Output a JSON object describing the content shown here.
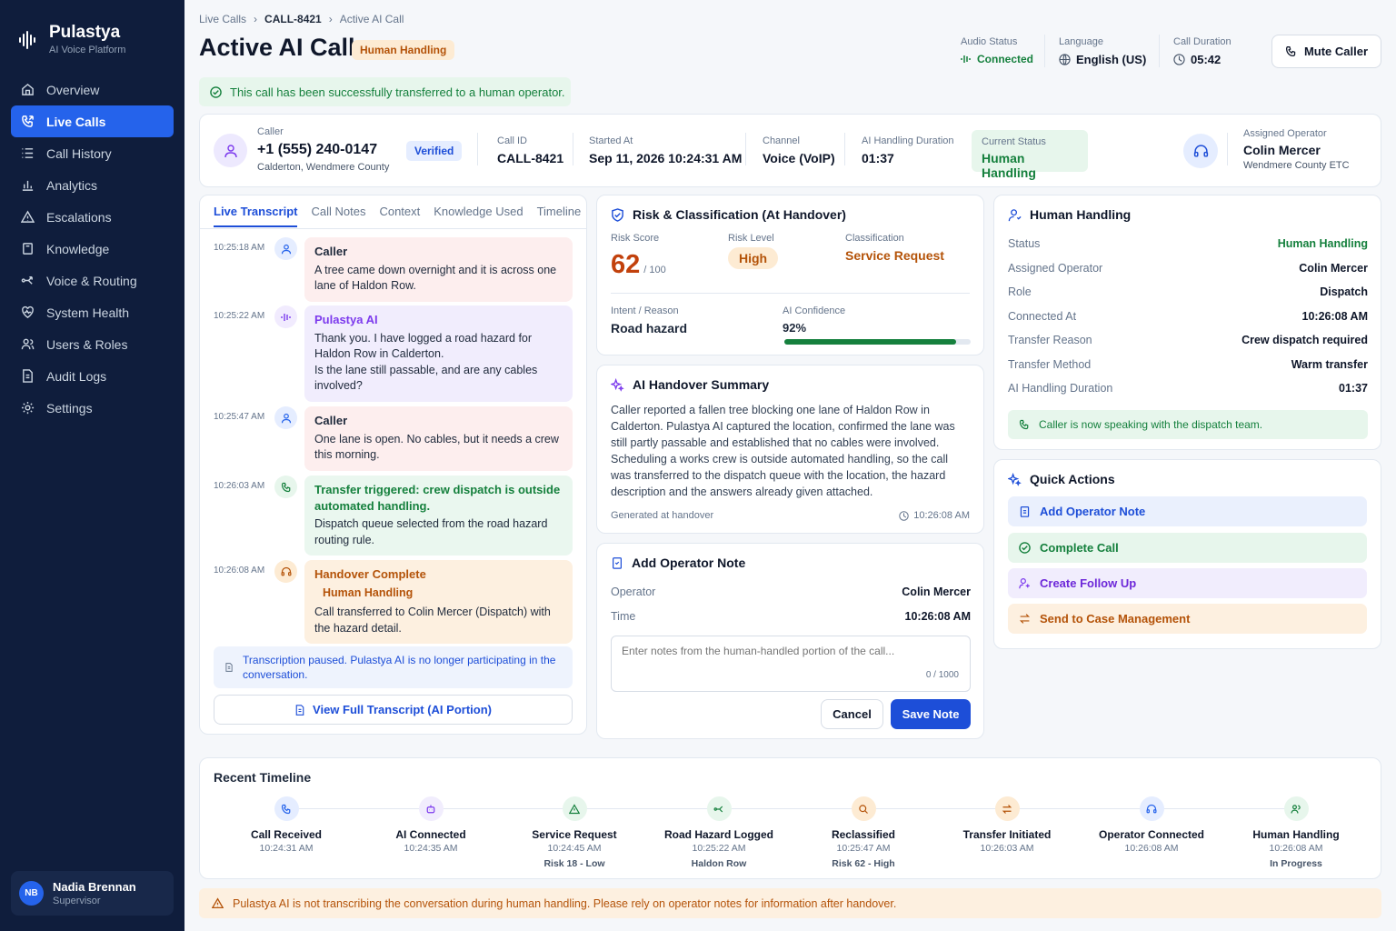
{
  "brand": {
    "name": "Pulastya",
    "subtitle": "AI Voice Platform"
  },
  "nav": [
    {
      "label": "Overview",
      "icon": "home-icon"
    },
    {
      "label": "Live Calls",
      "icon": "phone-call-icon",
      "active": true
    },
    {
      "label": "Call History",
      "icon": "list-icon"
    },
    {
      "label": "Analytics",
      "icon": "bar-chart-icon"
    },
    {
      "label": "Escalations",
      "icon": "warning-icon"
    },
    {
      "label": "Knowledge",
      "icon": "book-icon"
    },
    {
      "label": "Voice & Routing",
      "icon": "routing-icon"
    },
    {
      "label": "System Health",
      "icon": "heart-pulse-icon"
    },
    {
      "label": "Users & Roles",
      "icon": "users-icon"
    },
    {
      "label": "Audit Logs",
      "icon": "file-icon"
    },
    {
      "label": "Settings",
      "icon": "gear-icon"
    }
  ],
  "user": {
    "initials": "NB",
    "name": "Nadia Brennan",
    "role": "Supervisor"
  },
  "breadcrumb": {
    "a": "Live Calls",
    "b": "CALL-8421",
    "c": "Active AI Call"
  },
  "header": {
    "title": "Active AI Call",
    "badge": "Human Handling",
    "audio_label": "Audio Status",
    "audio_value": "Connected",
    "language_label": "Language",
    "language_value": "English (US)",
    "duration_label": "Call Duration",
    "duration_value": "05:42",
    "mute_button": "Mute Caller"
  },
  "transfer_banner": "This call has been successfully transferred to a human operator.",
  "caller_bar": {
    "caller_label": "Caller",
    "phone": "+1 (555) 240-0147",
    "location": "Calderton, Wendmere County",
    "verified": "Verified",
    "call_id_label": "Call ID",
    "call_id": "CALL-8421",
    "started_label": "Started At",
    "started": "Sep 11, 2026 10:24:31 AM",
    "channel_label": "Channel",
    "channel": "Voice (VoIP)",
    "ai_dur_label": "AI Handling Duration",
    "ai_dur": "01:37",
    "status_label": "Current Status",
    "status": "Human Handling",
    "operator_label": "Assigned Operator",
    "operator": "Colin Mercer",
    "operator_org": "Wendmere County ETC"
  },
  "transcript": {
    "tabs": [
      "Live Transcript",
      "Call Notes",
      "Context",
      "Knowledge Used",
      "Timeline"
    ],
    "messages": [
      {
        "time": "10:25:18 AM",
        "who": "Caller",
        "text": "A tree came down overnight and it is across one lane of Haldon Row."
      },
      {
        "time": "10:25:22 AM",
        "who": "Pulastya AI",
        "text": "Thank you. I have logged a road hazard for Haldon Row in Calderton.",
        "text2": "Is the lane still passable, and are any cables involved?"
      },
      {
        "time": "10:25:47 AM",
        "who": "Caller",
        "text": "One lane is open. No cables, but it needs a crew this morning."
      },
      {
        "time": "10:26:03 AM",
        "who": "Transfer triggered: crew dispatch is outside automated handling.",
        "text": "Dispatch queue selected from the road hazard routing rule."
      },
      {
        "time": "10:26:08 AM",
        "who": "Handover Complete",
        "tag": "Human Handling",
        "text": "Call transferred to Colin Mercer (Dispatch) with the hazard detail."
      }
    ],
    "paused": "Transcription paused. Pulastya AI is no longer participating in the conversation.",
    "view_full": "View Full Transcript (AI Portion)"
  },
  "risk": {
    "title": "Risk & Classification (At Handover)",
    "score_label": "Risk Score",
    "score": "62",
    "score_max": "/ 100",
    "level_label": "Risk Level",
    "level": "High",
    "class_label": "Classification",
    "class": "Service Request",
    "intent_label": "Intent / Reason",
    "intent": "Road hazard",
    "conf_label": "AI Confidence",
    "conf": "92%",
    "conf_value": 0.92
  },
  "summary": {
    "title": "AI Handover Summary",
    "text": "Caller reported a fallen tree blocking one lane of Haldon Row in Calderton. Pulastya AI captured the location, confirmed the lane was still partly passable and established that no cables were involved. Scheduling a works crew is outside automated handling, so the call was transferred to the dispatch queue with the location, the hazard description and the answers already given attached.",
    "generated": "Generated at handover",
    "generated_time": "10:26:08 AM"
  },
  "note": {
    "title": "Add Operator Note",
    "operator_label": "Operator",
    "operator": "Colin Mercer",
    "time_label": "Time",
    "time": "10:26:08 AM",
    "placeholder": "Enter notes from the human-handled portion of the call...",
    "counter": "0 / 1000",
    "cancel": "Cancel",
    "save": "Save Note"
  },
  "handling": {
    "title": "Human Handling",
    "rows": [
      {
        "k": "Status",
        "v": "Human Handling"
      },
      {
        "k": "Assigned Operator",
        "v": "Colin Mercer"
      },
      {
        "k": "Role",
        "v": "Dispatch"
      },
      {
        "k": "Connected At",
        "v": "10:26:08 AM"
      },
      {
        "k": "Transfer Reason",
        "v": "Crew dispatch required"
      },
      {
        "k": "Transfer Method",
        "v": "Warm transfer"
      },
      {
        "k": "AI Handling Duration",
        "v": "01:37"
      }
    ],
    "banner": "Caller is now speaking with the dispatch team."
  },
  "quick": {
    "title": "Quick Actions",
    "items": [
      "Add Operator Note",
      "Complete Call",
      "Create Follow Up",
      "Send to Case Management"
    ]
  },
  "timeline": {
    "title": "Recent Timeline",
    "items": [
      {
        "name": "Call Received",
        "time": "10:24:31 AM",
        "extra": ""
      },
      {
        "name": "AI Connected",
        "time": "10:24:35 AM",
        "extra": ""
      },
      {
        "name": "Service Request",
        "time": "10:24:45 AM",
        "extra": "Risk 18 - Low"
      },
      {
        "name": "Road Hazard Logged",
        "time": "10:25:22 AM",
        "extra": "Haldon Row"
      },
      {
        "name": "Reclassified",
        "time": "10:25:47 AM",
        "extra": "Risk 62 - High"
      },
      {
        "name": "Transfer Initiated",
        "time": "10:26:03 AM",
        "extra": ""
      },
      {
        "name": "Operator Connected",
        "time": "10:26:08 AM",
        "extra": ""
      },
      {
        "name": "Human Handling",
        "time": "10:26:08 AM",
        "extra": "In Progress"
      }
    ]
  },
  "footer_warning": "Pulastya AI is not transcribing the conversation during human handling. Please rely on operator notes for information after handover.",
  "colors": {
    "primary": "#2563eb",
    "sidebar": "#0f1d3c",
    "green": "#15803d",
    "orange": "#b45309",
    "purple": "#7c3aed"
  }
}
